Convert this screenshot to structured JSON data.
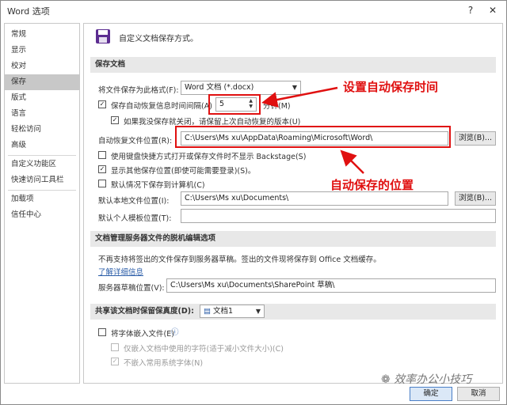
{
  "window": {
    "title": "Word 选项",
    "help_glyph": "?",
    "close_glyph": "✕"
  },
  "nav": {
    "items": [
      {
        "label": "常规"
      },
      {
        "label": "显示"
      },
      {
        "label": "校对"
      },
      {
        "label": "保存",
        "selected": true
      },
      {
        "label": "版式"
      },
      {
        "label": "语言"
      },
      {
        "label": "轻松访问"
      },
      {
        "label": "高级"
      },
      {
        "label": "自定义功能区"
      },
      {
        "label": "快速访问工具栏"
      },
      {
        "label": "加载项"
      },
      {
        "label": "信任中心"
      }
    ]
  },
  "header": {
    "text": "自定义文档保存方式。"
  },
  "save_section": {
    "title": "保存文档",
    "format_label": "将文件保存为此格式(F):",
    "format_value": "Word 文档 (*.docx)",
    "autorecover_label": "保存自动恢复信息时间间隔(A)",
    "autorecover_checked": true,
    "autorecover_minutes": "5",
    "minutes_label": "分钟(M)",
    "keep_last_label": "如果我没保存就关闭，请保留上次自动恢复的版本(U)",
    "keep_last_checked": true,
    "autorecover_path_label": "自动恢复文件位置(R):",
    "autorecover_path": "C:\\Users\\Ms xu\\AppData\\Roaming\\Microsoft\\Word\\",
    "browse_label": "浏览(B)...",
    "no_backstage_label": "使用键盘快捷方式打开或保存文件时不显示 Backstage(S)",
    "no_backstage_checked": false,
    "show_more_label": "显示其他保存位置(即使可能需要登录)(S)。",
    "show_more_checked": true,
    "default_computer_label": "默认情况下保存到计算机(C)",
    "default_computer_checked": false,
    "default_local_label": "默认本地文件位置(I):",
    "default_local_path": "C:\\Users\\Ms xu\\Documents\\",
    "browse2_label": "浏览(B)...",
    "personal_templates_label": "默认个人模板位置(T):",
    "personal_templates_path": ""
  },
  "annotations": {
    "autosave_time": "设置自动保存时间",
    "autosave_location": "自动保存的位置"
  },
  "offline_section": {
    "title": "文档管理服务器文件的脱机编辑选项",
    "notice": "不再支持将签出的文件保存到服务器草稿。签出的文件现将保存到 Office 文档缓存。",
    "learn_more": "了解详细信息",
    "drafts_label": "服务器草稿位置(V):",
    "drafts_path": "C:\\Users\\Ms xu\\Documents\\SharePoint 草稿\\"
  },
  "share_section": {
    "title": "共享该文档时保留保真度(D):",
    "doc_name": "文档1",
    "embed_fonts_label": "将字体嵌入文件(E)",
    "embed_fonts_checked": false,
    "info_glyph": "ⓘ",
    "only_used_label": "仅嵌入文档中使用的字符(适于减小文件大小)(C)",
    "only_used_checked": false,
    "no_common_label": "不嵌入常用系统字体(N)",
    "no_common_checked": true
  },
  "footer": {
    "ok_label": "确定",
    "cancel_label": "取消"
  },
  "watermark": "效率办公小技巧",
  "colors": {
    "annotation_red": "#e01010",
    "nav_selected": "#c8c8c8",
    "section_bg": "#e8e8e8",
    "link": "#2b5da8"
  }
}
